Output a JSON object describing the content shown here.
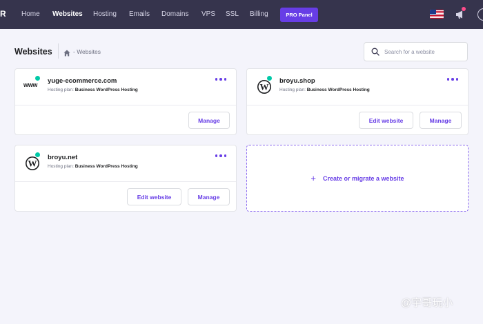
{
  "nav": {
    "logo": "R",
    "items": [
      {
        "label": "Home",
        "active": false
      },
      {
        "label": "Websites",
        "active": true
      },
      {
        "label": "Hosting",
        "active": false
      },
      {
        "label": "Emails",
        "active": false
      },
      {
        "label": "Domains",
        "active": false
      },
      {
        "label": "VPS",
        "active": false
      },
      {
        "label": "SSL",
        "active": false
      },
      {
        "label": "Billing",
        "active": false
      }
    ],
    "pro_panel": "PRO Panel",
    "flag_icon": "us-flag-icon",
    "announce_icon": "megaphone-icon"
  },
  "header": {
    "title": "Websites",
    "breadcrumb": "- Websites",
    "search_placeholder": "Search for a website"
  },
  "websites": [
    {
      "domain": "yuge-ecommerce.com",
      "icon": "www-icon",
      "icon_text": "www",
      "plan_label": "Hosting plan:",
      "plan": "Business WordPress Hosting",
      "buttons": [
        "Manage"
      ]
    },
    {
      "domain": "broyu.shop",
      "icon": "wordpress-icon",
      "plan_label": "Hosting plan:",
      "plan": "Business WordPress Hosting",
      "buttons": [
        "Edit website",
        "Manage"
      ]
    },
    {
      "domain": "broyu.net",
      "icon": "wordpress-icon",
      "plan_label": "Hosting plan:",
      "plan": "Business WordPress Hosting",
      "buttons": [
        "Edit website",
        "Manage"
      ]
    }
  ],
  "create": {
    "label": "Create or migrate a website"
  },
  "colors": {
    "accent": "#673de6",
    "nav_bg": "#36344d",
    "status": "#00c9a7",
    "page_bg": "#f4f4fb"
  },
  "watermark": "@宇哥玩小"
}
